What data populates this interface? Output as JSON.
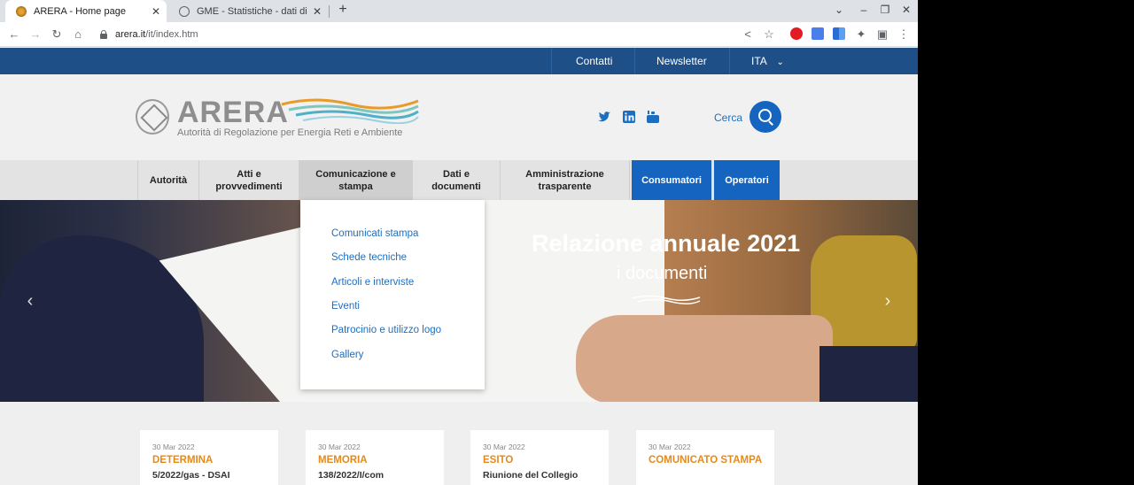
{
  "browser": {
    "tabs": [
      {
        "title": "ARERA - Home page",
        "active": true
      },
      {
        "title": "GME - Statistiche - dati di sintesi"
      }
    ],
    "url_host": "arera.it",
    "url_path": "/it/index.htm",
    "icons": {
      "back": "arrow-left-icon",
      "forward": "arrow-right-icon",
      "reload": "reload-icon",
      "home": "home-icon",
      "share": "share-icon",
      "bookmark": "star-icon",
      "extensions": "puzzle-icon",
      "sidebar": "side-panel-icon",
      "menu": "kebab-menu-icon"
    }
  },
  "topbar": {
    "contatti": "Contatti",
    "newsletter": "Newsletter",
    "lang": "ITA"
  },
  "header": {
    "logo_word": "ARERA",
    "logo_sub": "Autorità di Regolazione per Energia Reti e Ambiente",
    "search_label": "Cerca"
  },
  "nav": {
    "items": [
      {
        "label": "Autorità"
      },
      {
        "label": "Atti e\nprovvedimenti"
      },
      {
        "label": "Comunicazione e\nstampa"
      },
      {
        "label": "Dati e\ndocumenti"
      },
      {
        "label": "Amministrazione\ntrasparente"
      },
      {
        "label": "Consumatori"
      },
      {
        "label": "Operatori"
      }
    ]
  },
  "dropdown": {
    "items": [
      "Comunicati stampa",
      "Schede tecniche",
      "Articoli e interviste",
      "Eventi",
      "Patrocinio e utilizzo logo",
      "Gallery"
    ]
  },
  "hero": {
    "title": "Relazione annuale 2021",
    "subtitle": "i documenti"
  },
  "news": [
    {
      "date": "30 Mar 2022",
      "kind": "DETERMINA",
      "desc": "5/2022/gas - DSAI"
    },
    {
      "date": "30 Mar 2022",
      "kind": "MEMORIA",
      "desc": "138/2022/I/com"
    },
    {
      "date": "30 Mar 2022",
      "kind": "ESITO",
      "desc": "Riunione del Collegio"
    },
    {
      "date": "30 Mar 2022",
      "kind": "COMUNICATO STAMPA",
      "desc": ""
    }
  ],
  "colors": {
    "topbar": "#1e4f86",
    "accent_blue": "#1565c0",
    "news_orange": "#e58a1a",
    "link_blue": "#1e6ec0"
  }
}
